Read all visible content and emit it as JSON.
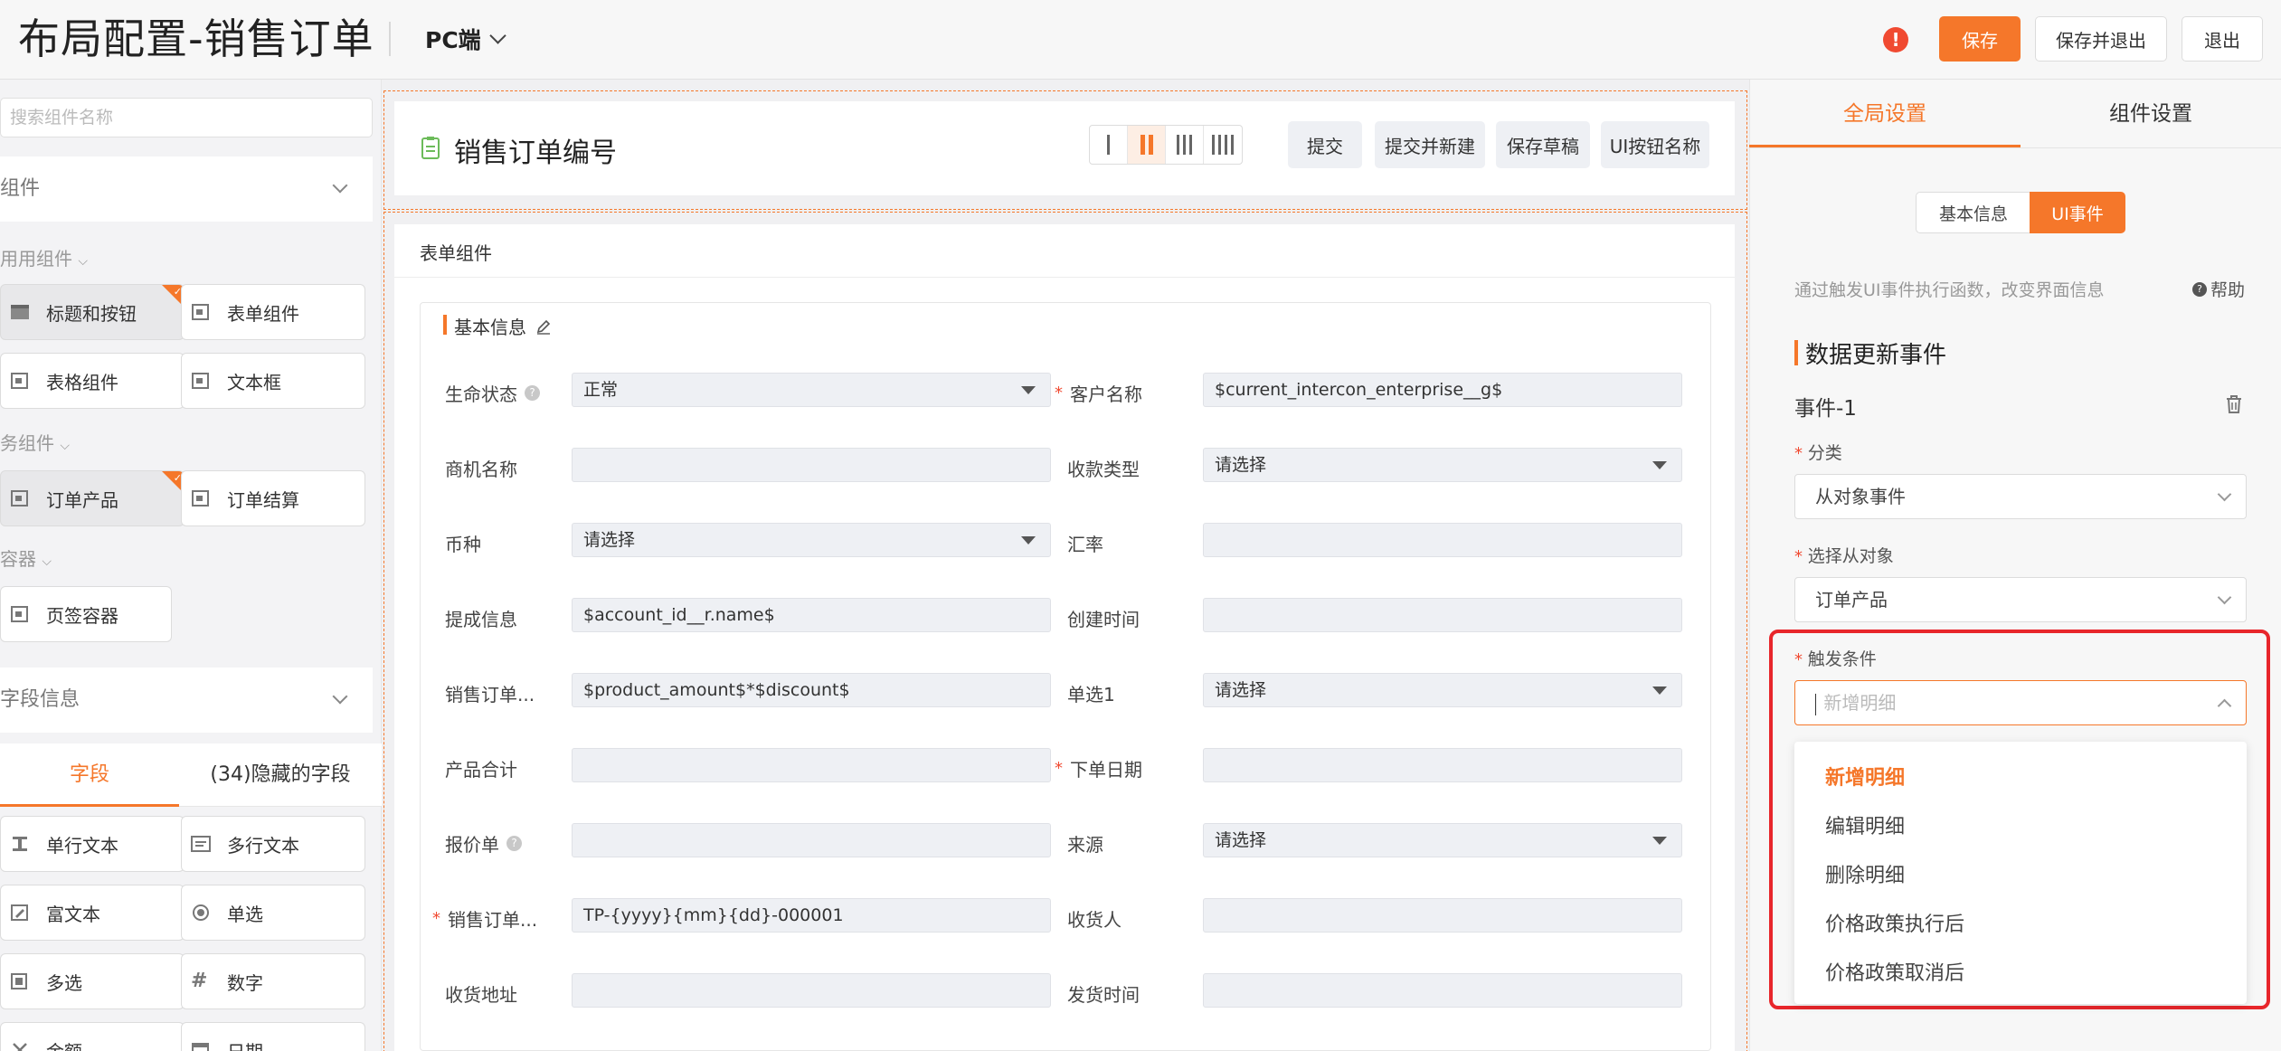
{
  "header": {
    "title": "布局配置-销售订单",
    "device": "PC端",
    "buttons": {
      "save": "保存",
      "save_exit": "保存并退出",
      "exit": "退出"
    },
    "warning_glyph": "!"
  },
  "left": {
    "search_placeholder": "搜索组件名称",
    "components_section": "组件",
    "groups": {
      "common": "用用组件",
      "business": "务组件",
      "container": "容器"
    },
    "common_items": [
      "标题和按钮",
      "表单组件",
      "表格组件",
      "文本框"
    ],
    "business_items": [
      "订单产品",
      "订单结算"
    ],
    "container_items": [
      "页签容器"
    ],
    "fields_section": "字段信息",
    "tabs": [
      "字段",
      "(34)隐藏的字段"
    ],
    "field_items": [
      "单行文本",
      "多行文本",
      "富文本",
      "单选",
      "多选",
      "数字",
      "金额",
      "日期"
    ]
  },
  "center": {
    "head_title": "销售订单编号",
    "actions": [
      "提交",
      "提交并新建",
      "保存草稿",
      "UI按钮名称"
    ],
    "form_section": "表单组件",
    "basic_info": "基本信息",
    "rows": [
      {
        "l_label": "生命状态",
        "l_help": true,
        "l_req": false,
        "l_value": "正常",
        "l_select": true,
        "r_label": "客户名称",
        "r_req": true,
        "r_value": "$current_intercon_enterprise__g$",
        "r_select": false
      },
      {
        "l_label": "商机名称",
        "l_help": false,
        "l_req": false,
        "l_value": "",
        "l_select": false,
        "r_label": "收款类型",
        "r_req": false,
        "r_value": "请选择",
        "r_select": true
      },
      {
        "l_label": "币种",
        "l_help": false,
        "l_req": false,
        "l_value": "请选择",
        "l_select": true,
        "r_label": "汇率",
        "r_req": false,
        "r_value": "",
        "r_select": false
      },
      {
        "l_label": "提成信息",
        "l_help": false,
        "l_req": false,
        "l_value": "$account_id__r.name$",
        "l_select": false,
        "r_label": "创建时间",
        "r_req": false,
        "r_value": "",
        "r_select": false
      },
      {
        "l_label": "销售订单...",
        "l_help": false,
        "l_req": false,
        "l_value": "$product_amount$*$discount$",
        "l_select": false,
        "r_label": "单选1",
        "r_req": false,
        "r_value": "请选择",
        "r_select": true
      },
      {
        "l_label": "产品合计",
        "l_help": false,
        "l_req": false,
        "l_value": "",
        "l_select": false,
        "r_label": "下单日期",
        "r_req": true,
        "r_value": "",
        "r_select": false
      },
      {
        "l_label": "报价单",
        "l_help": true,
        "l_req": false,
        "l_value": "",
        "l_select": false,
        "r_label": "来源",
        "r_req": false,
        "r_value": "请选择",
        "r_select": true
      },
      {
        "l_label": "销售订单...",
        "l_help": false,
        "l_req": true,
        "l_value": "TP-{yyyy}{mm}{dd}-000001",
        "l_select": false,
        "r_label": "收货人",
        "r_req": false,
        "r_value": "",
        "r_select": false
      },
      {
        "l_label": "收货地址",
        "l_help": false,
        "l_req": false,
        "l_value": "",
        "l_select": false,
        "r_label": "发货时间",
        "r_req": false,
        "r_value": "",
        "r_select": false
      }
    ]
  },
  "right": {
    "tabs": [
      "全局设置",
      "组件设置"
    ],
    "pills": [
      "基本信息",
      "UI事件"
    ],
    "description": "通过触发UI事件执行函数，改变界面信息",
    "help": "帮助",
    "event_section": "数据更新事件",
    "event_name": "事件-1",
    "category_label": "分类",
    "category_value": "从对象事件",
    "object_label": "选择从对象",
    "object_value": "订单产品",
    "trigger_label": "触发条件",
    "trigger_placeholder": "新增明细",
    "options": [
      "新增明细",
      "编辑明细",
      "删除明细",
      "价格政策执行后",
      "价格政策取消后"
    ],
    "selected_option": "新增明细"
  },
  "colors": {
    "accent": "#f5772a",
    "highlight": "#e8262b",
    "warning": "#f04a31"
  }
}
